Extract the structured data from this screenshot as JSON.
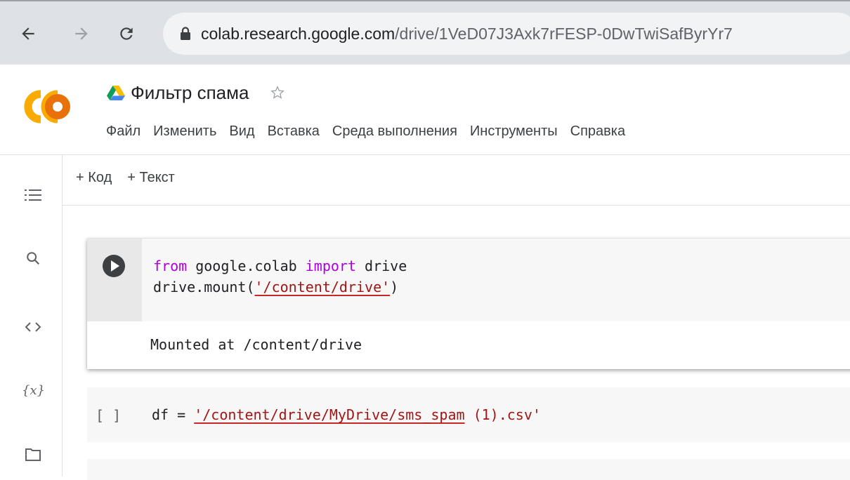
{
  "browser": {
    "url_domain": "colab.research.google.com",
    "url_path": "/drive/1VeD07J3Axk7rFESP-0DwTwiSafByrYr7"
  },
  "colab": {
    "title": "Фильтр спама",
    "menu": [
      "Файл",
      "Изменить",
      "Вид",
      "Вставка",
      "Среда выполнения",
      "Инструменты",
      "Справка"
    ],
    "toolbar": {
      "add_code": "+ Код",
      "add_text": "+ Текст"
    }
  },
  "rail_icons": [
    "toc-icon",
    "search-icon",
    "code-snippets-icon",
    "variables-icon",
    "files-icon"
  ],
  "cells": [
    {
      "line1": {
        "kw1": "from",
        "mid": " google.colab ",
        "kw2": "import",
        "end": " drive"
      },
      "line2": {
        "pre": "drive.mount(",
        "str": "'/content/drive'",
        "post": ")"
      },
      "output": "Mounted at /content/drive"
    },
    {
      "brackets": "[ ]",
      "line": {
        "pre": "df = ",
        "str": "'/content/drive/MyDrive/sms_spam",
        "str2": " (1).csv'"
      }
    }
  ],
  "colors": {
    "keyword": "#af00db",
    "string": "#a31515",
    "accent_orange": "#f9ab00"
  }
}
